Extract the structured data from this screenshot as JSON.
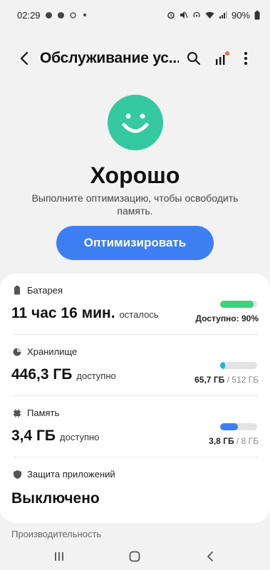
{
  "status_bar": {
    "time": "02:29",
    "battery": "90%",
    "icons": [
      "notification-icon",
      "notification-icon",
      "notification-ring-icon",
      "dot-icon",
      "alarm-icon",
      "mute-icon",
      "hotspot-icon",
      "wifi-icon",
      "signal-icon",
      "battery-icon"
    ]
  },
  "app_bar": {
    "title": "Обслуживание ус...",
    "icons": [
      "back-icon",
      "search-icon",
      "stats-icon",
      "more-icon"
    ],
    "badge_color": "#e8763a"
  },
  "hero": {
    "status": "Хорошо",
    "subtitle": "Выполните оптимизацию, чтобы освободить память.",
    "button": "Оптимизировать",
    "face_color": "#34c99f"
  },
  "rows": [
    {
      "label": "Батарея",
      "icon": "battery-icon",
      "value": "11 час 16 мин.",
      "suffix": "осталось",
      "right_text": "Доступно: 90%",
      "level": 0.9,
      "color": "#3fd07a"
    },
    {
      "label": "Хранилище",
      "icon": "storage-icon",
      "value": "446,3 ГБ",
      "suffix": "доступно",
      "used": "65,7 ГБ",
      "separator": " / ",
      "total": "512 ГБ",
      "level": 0.13,
      "color": "#1fb7d6"
    },
    {
      "label": "Память",
      "icon": "memory-icon",
      "value": "3,4 ГБ",
      "suffix": "доступно",
      "used": "3,8 ГБ",
      "separator": " / ",
      "total": "8 ГБ",
      "level": 0.475,
      "color": "#3d7ff2"
    },
    {
      "label": "Защита приложений",
      "icon": "shield-icon",
      "value": "Выключено"
    }
  ],
  "section": {
    "performance": "Производительность"
  },
  "nav": {
    "icons": [
      "recents-icon",
      "home-icon",
      "back-nav-icon"
    ]
  }
}
